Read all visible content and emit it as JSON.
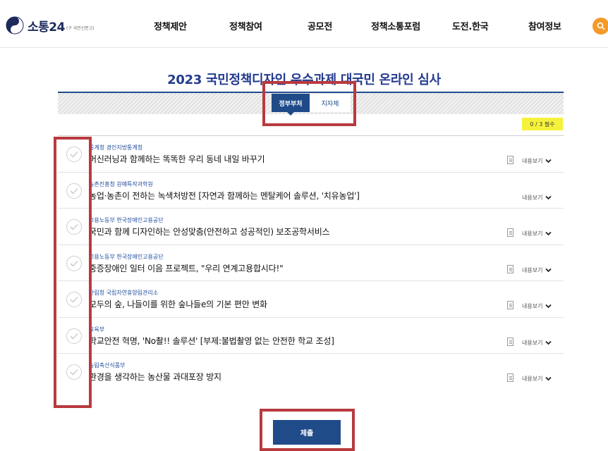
{
  "header": {
    "logo_text": "소통24",
    "logo_sub": "(구 국민신문고)",
    "nav": [
      "정책제안",
      "정책참여",
      "공모전",
      "정책소통포럼",
      "도전.한국",
      "참여정보"
    ]
  },
  "page_title": "2023 국민정책디자인 우수과제 대국민 온라인 심사",
  "tabs": {
    "active": "정부부처",
    "inactive": "지자체"
  },
  "counter": "0 / 3 필수",
  "view_label": "내용보기",
  "items": [
    {
      "org": "통계청 경인지방통계청",
      "title": "머신러닝과 함께하는 똑똑한 우리 동네 내일 바꾸기"
    },
    {
      "org": "농촌진흥청 원예특작과학원",
      "title": "농업·농촌이 전하는 녹색처방전 [자연과 함께하는 멘탈케어 솔루션, '치유농업']"
    },
    {
      "org": "고용노동부 한국장애인고용공단",
      "title": "국민과 함께 디자인하는 안성맞춤(안전하고 성공적인) 보조공학서비스"
    },
    {
      "org": "고용노동부 한국장애인고용공단",
      "title": "중증장애인 일터 이음 프로젝트, \"우리 연계고용합시다!\""
    },
    {
      "org": "산림청 국립자연휴양림관리소",
      "title": "모두의 숲, 나들이를 위한 숲나들e의 기본 편안 변화"
    },
    {
      "org": "교육부",
      "title": "학교안전 혁명, 'No촬!! 솔루션' [부제:불법촬영 없는 안전한 학교 조성]"
    },
    {
      "org": "농림축산식품부",
      "title": "환경을 생각하는 농산물 과대포장 방지"
    }
  ],
  "submit_label": "제출",
  "colors": {
    "primary": "#1f4b88",
    "title": "#233a8f",
    "highlight": "#f5f23c",
    "annotation": "#b83a3f",
    "search": "#f39a2a"
  }
}
